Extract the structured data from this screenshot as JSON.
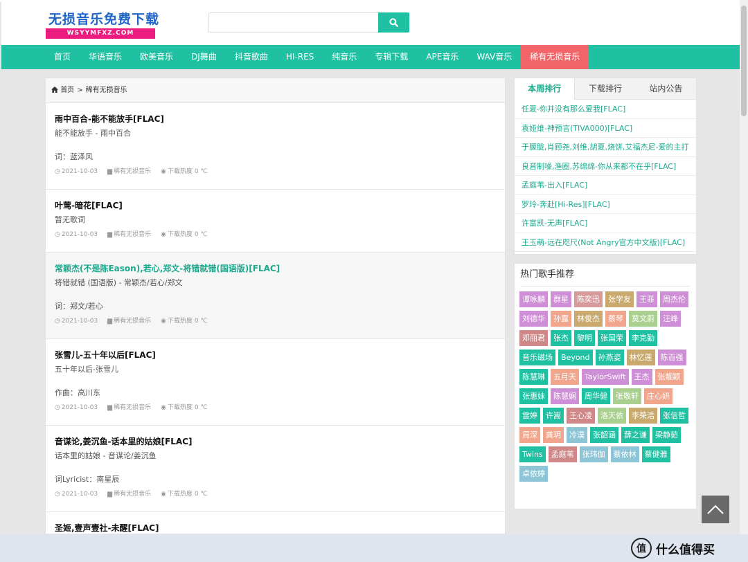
{
  "header": {
    "logo_text": "无损音乐免费下载",
    "logo_sub": "WSYYMFXZ.COM",
    "search_placeholder": "",
    "search_value": ""
  },
  "nav": {
    "items": [
      {
        "label": "首页",
        "active": false
      },
      {
        "label": "华语音乐",
        "active": false
      },
      {
        "label": "欧美音乐",
        "active": false
      },
      {
        "label": "DJ舞曲",
        "active": false
      },
      {
        "label": "抖音歌曲",
        "active": false
      },
      {
        "label": "HI-RES",
        "active": false
      },
      {
        "label": "纯音乐",
        "active": false
      },
      {
        "label": "专辑下载",
        "active": false
      },
      {
        "label": "APE音乐",
        "active": false
      },
      {
        "label": "WAV音乐",
        "active": false
      },
      {
        "label": "稀有无损音乐",
        "active": true
      }
    ]
  },
  "breadcrumb": {
    "home": "首页",
    "separator": ">",
    "current": "稀有无损音乐"
  },
  "posts": [
    {
      "title": "雨中百合-能不能放手[FLAC]",
      "excerpt": "能不能放手 - 雨中百合",
      "lyric": "词：蓝泽风",
      "date": "2021-10-03",
      "category": "稀有无损音乐",
      "heat": "下载热度 0 ℃"
    },
    {
      "title": "叶莺-暗花[FLAC]",
      "excerpt": "暂无歌词",
      "lyric": "",
      "date": "2021-10-03",
      "category": "稀有无损音乐",
      "heat": "下载热度 0 ℃"
    },
    {
      "title": "常颖杰(不是陈Eason),若心,郑文-将错就错(国语版)[FLAC]",
      "excerpt": "将错就错 (国语版) - 常颖杰/若心/郑文",
      "lyric": "词：郑文/若心",
      "date": "2021-10-03",
      "category": "稀有无损音乐",
      "heat": "下载热度 0 ℃"
    },
    {
      "title": "张雪儿-五十年以后[FLAC]",
      "excerpt": "五十年以后-张雪儿",
      "lyric": "作曲：高川东",
      "date": "2021-10-03",
      "category": "稀有无损音乐",
      "heat": "下载热度 0 ℃"
    },
    {
      "title": "音谋论,姜沉鱼-话本里的姑娘[FLAC]",
      "excerpt": "话本里的姑娘 - 音谋论/姜沉鱼",
      "lyric": "词Lyricist：南星辰",
      "date": "2021-10-03",
      "category": "稀有无损音乐",
      "heat": "下载热度 0 ℃"
    },
    {
      "title": "圣姬,壹声壹社-未醒[FLAC]",
      "excerpt": "",
      "lyric": "",
      "date": "",
      "category": "",
      "heat": ""
    }
  ],
  "sidebar": {
    "tabs": [
      {
        "label": "本周排行",
        "active": true
      },
      {
        "label": "下载排行",
        "active": false
      },
      {
        "label": "站内公告",
        "active": false
      }
    ],
    "ranking": [
      "任夏-你并没有那么爱我[FLAC]",
      "袁娅维-神预言(TIVA000)[FLAC]",
      "于朦胧,肖顾尧,刘维,胡夏,烧饼,艾福杰尼-爱的主打",
      "良音制噪,渔圈,苏绵绵-你从来都不在乎[FLAC]",
      "孟庭苇-出入[FLAC]",
      "罗玲-奔赴[Hi-Res][FLAC]",
      "许富凯-无声[FLAC]",
      "王玉萌-远在咫尺(Not Angry官方中文版)[FLAC]"
    ],
    "singers_title": "热门歌手推荐",
    "singers": [
      {
        "name": "谭咏麟",
        "color": "#cf8fd6"
      },
      {
        "name": "群星",
        "color": "#cf8fd6"
      },
      {
        "name": "陈奕迅",
        "color": "#d79b9b"
      },
      {
        "name": "张学友",
        "color": "#c9a96e"
      },
      {
        "name": "王菲",
        "color": "#cf8fd6"
      },
      {
        "name": "周杰伦",
        "color": "#cf8fd6"
      },
      {
        "name": "刘德华",
        "color": "#cf8fd6"
      },
      {
        "name": "孙露",
        "color": "#f0a58c"
      },
      {
        "name": "林俊杰",
        "color": "#c9a96e"
      },
      {
        "name": "蔡琴",
        "color": "#f0a58c"
      },
      {
        "name": "莫文蔚",
        "color": "#a9d08e"
      },
      {
        "name": "汪峰",
        "color": "#cf8fd6"
      },
      {
        "name": "邓丽君",
        "color": "#d08787"
      },
      {
        "name": "张杰",
        "color": "#20c1a2"
      },
      {
        "name": "黎明",
        "color": "#20c1a2"
      },
      {
        "name": "张国荣",
        "color": "#20c1a2"
      },
      {
        "name": "李克勤",
        "color": "#20c1a2"
      },
      {
        "name": "音乐磁场",
        "color": "#20c1a2"
      },
      {
        "name": "Beyond",
        "color": "#20c1a2"
      },
      {
        "name": "孙燕姿",
        "color": "#20c1a2"
      },
      {
        "name": "林忆莲",
        "color": "#c9a96e"
      },
      {
        "name": "陈百强",
        "color": "#cf8fd6"
      },
      {
        "name": "陈慧琳",
        "color": "#20c1a2"
      },
      {
        "name": "五月天",
        "color": "#f0a58c"
      },
      {
        "name": "TaylorSwift",
        "color": "#cf8fd6"
      },
      {
        "name": "王杰",
        "color": "#cf8fd6"
      },
      {
        "name": "张靓颖",
        "color": "#f0a58c"
      },
      {
        "name": "张惠妹",
        "color": "#20c1a2"
      },
      {
        "name": "陈慧娴",
        "color": "#cf8fd6"
      },
      {
        "name": "周华健",
        "color": "#20c1a2"
      },
      {
        "name": "张敬轩",
        "color": "#a9d08e"
      },
      {
        "name": "庄心妍",
        "color": "#f0a58c"
      },
      {
        "name": "雷婷",
        "color": "#20c1a2"
      },
      {
        "name": "许嵩",
        "color": "#20c1a2"
      },
      {
        "name": "王心凌",
        "color": "#d08787"
      },
      {
        "name": "洛天依",
        "color": "#a9d08e"
      },
      {
        "name": "李荣浩",
        "color": "#c9a96e"
      },
      {
        "name": "张信哲",
        "color": "#20c1a2"
      },
      {
        "name": "周深",
        "color": "#f0a58c"
      },
      {
        "name": "龚玥",
        "color": "#f0a58c"
      },
      {
        "name": "冷漠",
        "color": "#8ec5d6"
      },
      {
        "name": "张韶涵",
        "color": "#20c1a2"
      },
      {
        "name": "薛之谦",
        "color": "#20c1a2"
      },
      {
        "name": "梁静茹",
        "color": "#20c1a2"
      },
      {
        "name": "Twins",
        "color": "#20c1a2"
      },
      {
        "name": "孟庭苇",
        "color": "#d08787"
      },
      {
        "name": "张玮伽",
        "color": "#8ec5d6"
      },
      {
        "name": "蔡依林",
        "color": "#8ec5d6"
      },
      {
        "name": "蔡健雅",
        "color": "#20c1a2"
      },
      {
        "name": "卓依婷",
        "color": "#8ec5d6"
      }
    ]
  },
  "watermark": {
    "icon_text": "值",
    "text": "什么值得买"
  }
}
